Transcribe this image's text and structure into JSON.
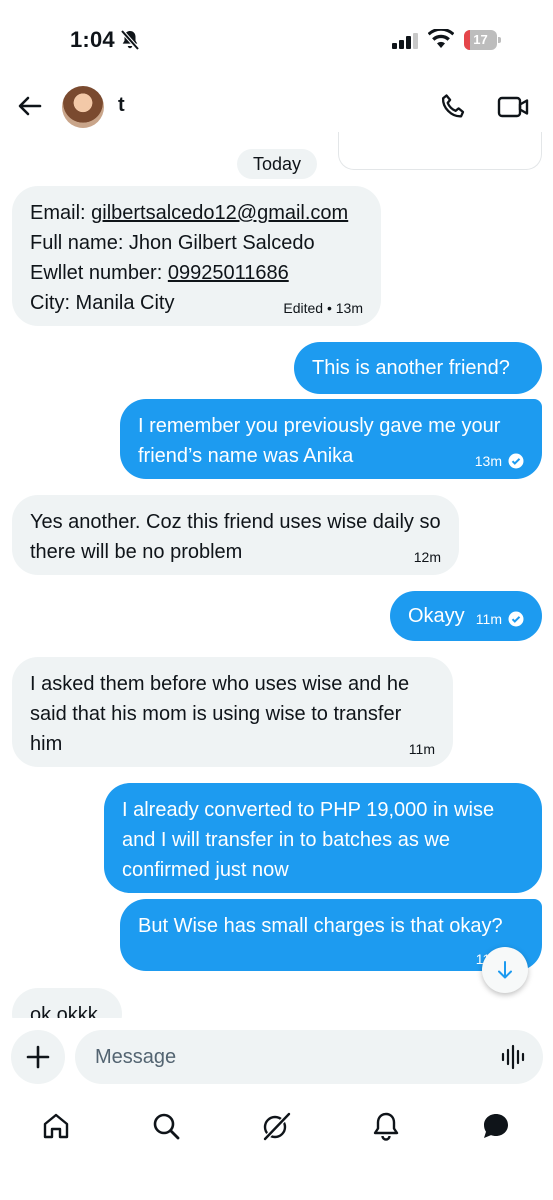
{
  "status_bar": {
    "time": "1:04",
    "battery": "17",
    "battery_level": 0.17
  },
  "header": {
    "contact_name": "t"
  },
  "chat": {
    "date_separator": "Today",
    "messages": [
      {
        "lines": [
          {
            "prefix": "Email: ",
            "link": "gilbertsalcedo12@gmail.com"
          },
          {
            "prefix": "Full name: Jhon Gilbert Salcedo",
            "link": ""
          },
          {
            "prefix": "Ewllet number: ",
            "link": "09925011686"
          },
          {
            "prefix": "City: Manila City",
            "link": ""
          }
        ],
        "meta": "Edited • 13m"
      },
      {
        "text": "This is another friend?"
      },
      {
        "text": "I remember you previously gave me your friend’s name was Anika",
        "meta": "13m"
      },
      {
        "text": "Yes another. Coz this friend uses wise daily so there will be no problem",
        "meta": "12m"
      },
      {
        "text": "Okayy",
        "meta": "11m"
      },
      {
        "text": "I asked them before who uses wise and he said that his mom is using wise to transfer him",
        "meta": "11m"
      },
      {
        "text": "I already converted to PHP 19,000 in wise and I will transfer in to batches as we confirmed just now"
      },
      {
        "text": "But Wise has small charges is that okay?",
        "meta": "11m"
      },
      {
        "text": "ok okkk"
      }
    ]
  },
  "composer": {
    "placeholder": "Message"
  },
  "icons": {
    "back": "back-arrow-icon",
    "call": "phone-icon",
    "video": "video-camera-icon",
    "add": "plus-icon",
    "voice": "voice-waveform-icon",
    "tabs": [
      "home-icon",
      "search-icon",
      "grok-icon",
      "notifications-icon",
      "messages-icon"
    ]
  },
  "colors": {
    "outgoing": "#1d9bf0",
    "incoming": "#eff3f4",
    "text": "#0f1419",
    "battery_low": "#e5454a"
  }
}
